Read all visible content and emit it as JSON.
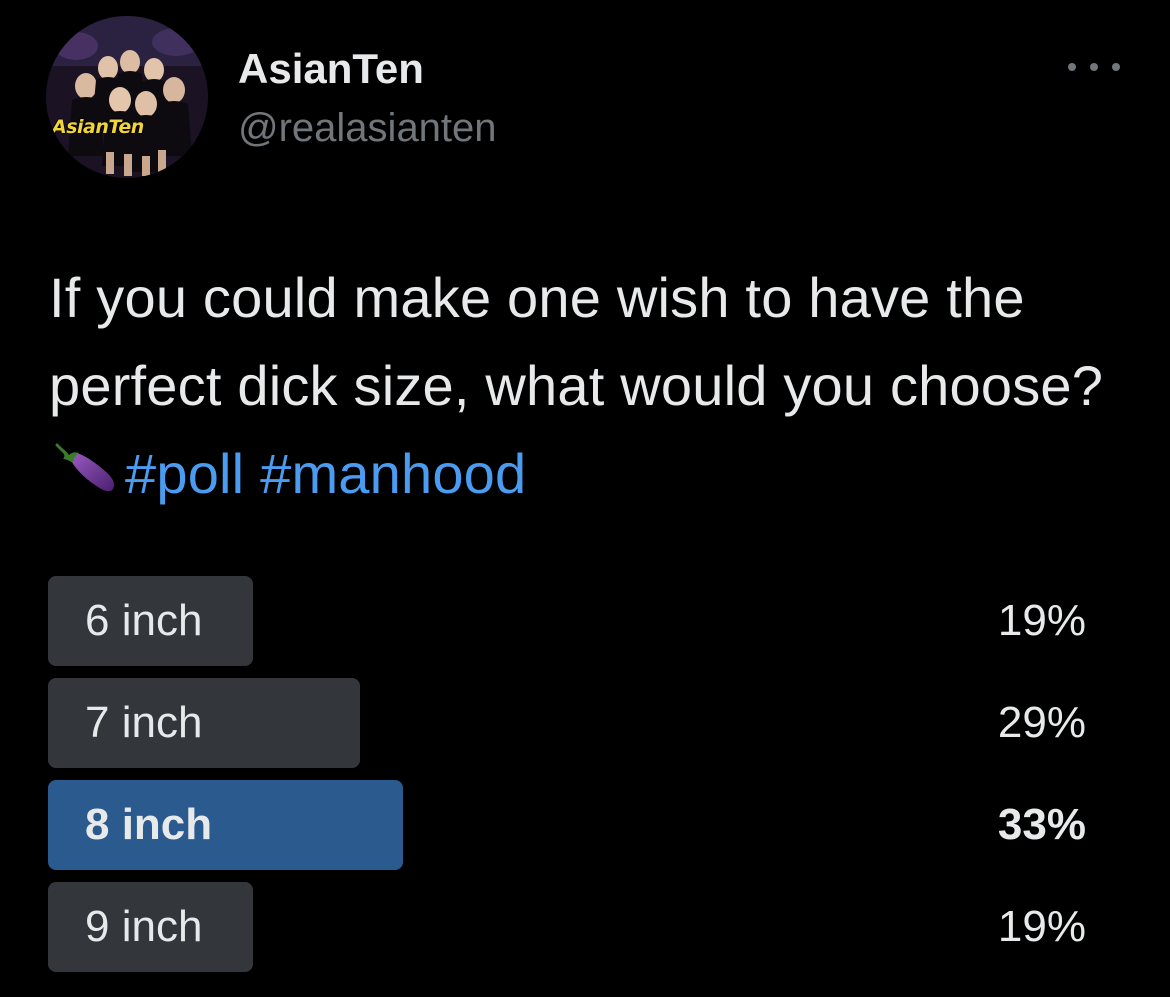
{
  "author": {
    "display_name": "AsianTen",
    "handle": "@realasianten",
    "avatar_logo_text": "AsianTen",
    "avatar_icon": "profile-avatar-group-photo"
  },
  "more_icon": "ellipsis-horizontal-icon",
  "tweet": {
    "text_main": "If you could make one wish to have the perfect dick size, what would you choose?",
    "emoji": "eggplant-emoji-icon",
    "hashtags": [
      "#poll",
      "#manhood"
    ]
  },
  "poll": {
    "options": [
      {
        "label": "6 inch",
        "percent_text": "19%",
        "percent": 19,
        "winner": false
      },
      {
        "label": "7 inch",
        "percent_text": "29%",
        "percent": 29,
        "winner": false
      },
      {
        "label": "8 inch",
        "percent_text": "33%",
        "percent": 33,
        "winner": true
      },
      {
        "label": "9 inch",
        "percent_text": "19%",
        "percent": 19,
        "winner": false
      }
    ]
  },
  "colors": {
    "background": "#000000",
    "text_primary": "#e7e9ea",
    "text_secondary": "#71767b",
    "hashtag": "#4a9cf0",
    "poll_bar": "#33363b",
    "poll_bar_winner": "#2a5a8e"
  }
}
